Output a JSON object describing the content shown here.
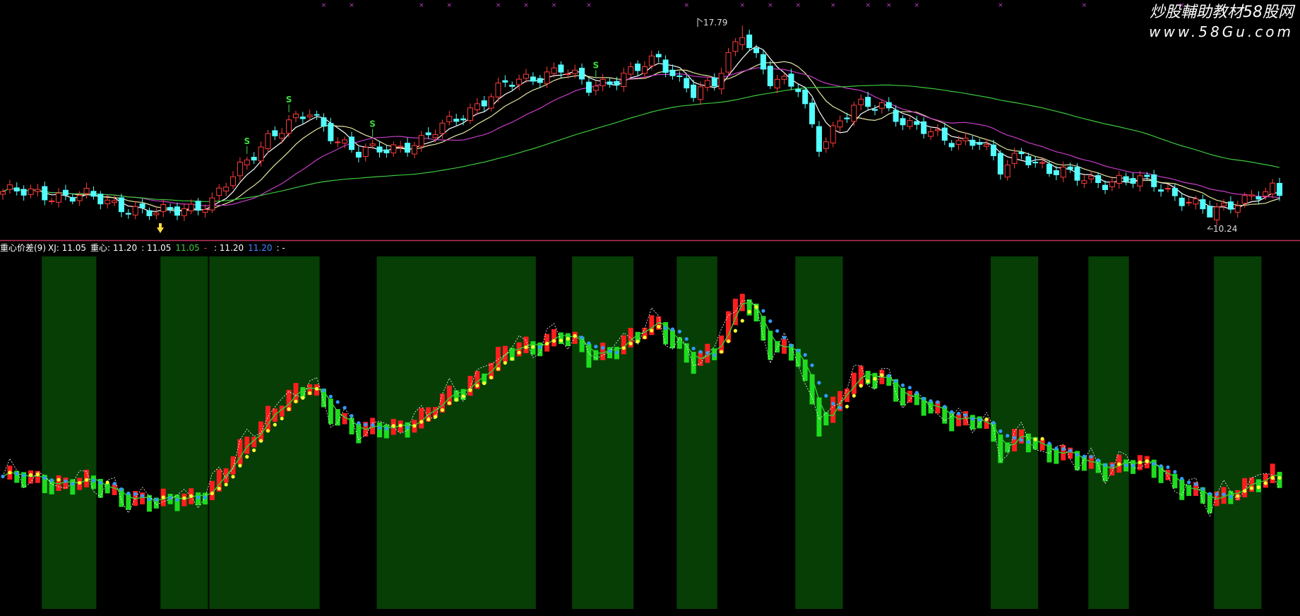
{
  "app": {
    "watermark_line1": "炒股輔助教材58股网",
    "watermark_line2": "www.58Gu.com"
  },
  "main_chart": {
    "high_marker": "17.79",
    "low_marker": "10.24",
    "signal_glyph": "S",
    "signal_count": 4,
    "colors": {
      "up": "#ff3c3c",
      "down": "#54ffff",
      "ma_short": "#ffffff",
      "ma_mid": "#e6e6a0",
      "ma_long": "#c83cc8",
      "ma_slow": "#3cc83c",
      "frame": "#c0305a"
    }
  },
  "indicator": {
    "header_name": "重心价差(9)",
    "header_items": [
      {
        "label": "XJ:",
        "value": "11.05",
        "color": "#ffffff"
      },
      {
        "label": "重心:",
        "value": "11.20",
        "color": "#ffffff"
      },
      {
        "label": ":",
        "value": "11.05",
        "color": "#ffffff"
      },
      {
        "label": "",
        "value": "11.05",
        "color": "#3cd03c"
      },
      {
        "label": "-",
        "value": "",
        "color": "#ff3c3c"
      },
      {
        "label": ":",
        "value": "11.20",
        "color": "#ffffff"
      },
      {
        "label": "",
        "value": "11.20",
        "color": "#3c8cff"
      },
      {
        "label": ":",
        "value": "-",
        "color": "#ffffff"
      }
    ],
    "colors": {
      "zone": "#063e06",
      "bar_up": "#ff1e1e",
      "bar_down": "#1edc1e",
      "dot_up": "#ffff32",
      "dot_down": "#329bff",
      "line": "#2dd22d",
      "dash": "#ffffff"
    }
  },
  "chart_data": {
    "type": "candlestick",
    "ylim": [
      9.5,
      18.3
    ],
    "high_point": 17.79,
    "low_point": 10.24,
    "last_close": 11.05,
    "gravity_center_last": 11.2,
    "keypoints_close": [
      [
        0,
        11.2
      ],
      [
        12,
        11.0
      ],
      [
        22,
        10.3
      ],
      [
        30,
        10.8
      ],
      [
        38,
        13.4
      ],
      [
        44,
        14.3
      ],
      [
        48,
        13.3
      ],
      [
        51,
        12.7
      ],
      [
        55,
        12.9
      ],
      [
        60,
        13.2
      ],
      [
        72,
        15.4
      ],
      [
        80,
        16.1
      ],
      [
        84,
        15.3
      ],
      [
        94,
        16.4
      ],
      [
        99,
        15.2
      ],
      [
        102,
        15.4
      ],
      [
        106,
        17.6
      ],
      [
        110,
        15.6
      ],
      [
        114,
        15.3
      ],
      [
        117,
        13.1
      ],
      [
        122,
        14.5
      ],
      [
        126,
        14.7
      ],
      [
        130,
        13.8
      ],
      [
        135,
        13.3
      ],
      [
        140,
        13.2
      ],
      [
        143,
        12.0
      ],
      [
        146,
        12.8
      ],
      [
        150,
        12.0
      ],
      [
        158,
        11.6
      ],
      [
        165,
        11.6
      ],
      [
        169,
        10.9
      ],
      [
        173,
        10.3
      ],
      [
        177,
        10.9
      ],
      [
        182,
        11.2
      ],
      [
        183,
        11.0
      ]
    ],
    "green_zone_bar_ranges": [
      [
        6,
        13
      ],
      [
        23,
        29
      ],
      [
        30,
        45
      ],
      [
        54,
        76
      ],
      [
        82,
        90
      ],
      [
        97,
        102
      ],
      [
        114,
        120
      ],
      [
        142,
        148
      ],
      [
        156,
        161
      ],
      [
        174,
        180
      ]
    ]
  }
}
